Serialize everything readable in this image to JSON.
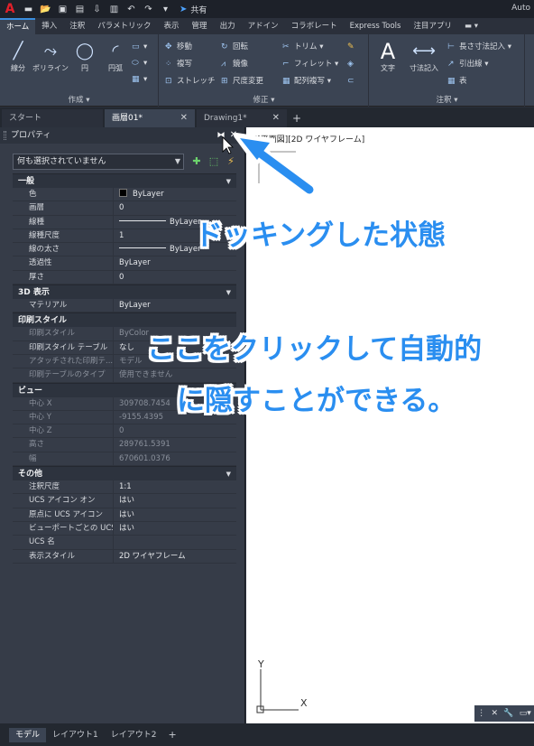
{
  "titlebar": {
    "logo": "A",
    "share_label": "共有",
    "app_title": "Auto"
  },
  "ribbon_tabs": [
    "ホーム",
    "挿入",
    "注釈",
    "パラメトリック",
    "表示",
    "管理",
    "出力",
    "アドイン",
    "コラボレート",
    "Express Tools",
    "注目アプリ",
    ""
  ],
  "ribbon": {
    "draw": {
      "label": "作成 ▾",
      "line": "線分",
      "polyline": "ポリライン",
      "circle": "円",
      "arc": "円弧"
    },
    "modify": {
      "label": "修正 ▾",
      "move": "移動",
      "rotate": "回転",
      "trim": "トリム",
      "copy": "複写",
      "mirror": "鏡像",
      "fillet": "フィレット",
      "stretch": "ストレッチ",
      "scale": "尺度変更",
      "array": "配列複写"
    },
    "annotation": {
      "label": "注釈 ▾",
      "text": "文字",
      "dimension": "寸法記入",
      "linear": "長さ寸法記入",
      "leader": "引出線",
      "table": "表"
    }
  },
  "doc_tabs": [
    {
      "label": "スタート",
      "close": ""
    },
    {
      "label": "画層01*",
      "close": "✕"
    },
    {
      "label": "Drawing1*",
      "close": "✕"
    }
  ],
  "palette": {
    "title": "プロパティ",
    "selection": "何も選択されていません",
    "categories": [
      {
        "name": "一般",
        "rows": [
          {
            "k": "色",
            "v": "ByLayer"
          },
          {
            "k": "画層",
            "v": "0"
          },
          {
            "k": "線種",
            "v": "ByLayer"
          },
          {
            "k": "線種尺度",
            "v": "1"
          },
          {
            "k": "線の太さ",
            "v": "ByLayer"
          },
          {
            "k": "透過性",
            "v": "ByLayer"
          },
          {
            "k": "厚さ",
            "v": "0"
          }
        ]
      },
      {
        "name": "3D 表示",
        "rows": [
          {
            "k": "マテリアル",
            "v": "ByLayer"
          }
        ]
      },
      {
        "name": "印刷スタイル",
        "rows": [
          {
            "k": "印刷スタイル",
            "v": "ByColor"
          },
          {
            "k": "印刷スタイル テーブル",
            "v": "なし"
          },
          {
            "k": "アタッチされた印刷テ...",
            "v": "モデル"
          },
          {
            "k": "印刷テーブルのタイプ",
            "v": "使用できません"
          }
        ]
      },
      {
        "name": "ビュー",
        "rows": [
          {
            "k": "中心 X",
            "v": "309708.7454"
          },
          {
            "k": "中心 Y",
            "v": "-9155.4395"
          },
          {
            "k": "中心 Z",
            "v": "0"
          },
          {
            "k": "高さ",
            "v": "289761.5391"
          },
          {
            "k": "幅",
            "v": "670601.0376"
          }
        ]
      },
      {
        "name": "その他",
        "rows": [
          {
            "k": "注釈尺度",
            "v": "1:1"
          },
          {
            "k": "UCS アイコン オン",
            "v": "はい"
          },
          {
            "k": "原点に UCS アイコン",
            "v": "はい"
          },
          {
            "k": "ビューポートごとの UCS",
            "v": "はい"
          },
          {
            "k": "UCS 名",
            "v": ""
          },
          {
            "k": "表示スタイル",
            "v": "2D ワイヤフレーム"
          }
        ]
      }
    ]
  },
  "canvas": {
    "viewport_label": "[-][平面図][2D ワイヤフレーム]",
    "ucs_x": "X",
    "ucs_y": "Y"
  },
  "layout_tabs": [
    "モデル",
    "レイアウト1",
    "レイアウト2"
  ],
  "annotations": {
    "docked": "ドッキングした状態",
    "hint_line1": "ここをクリックして自動的",
    "hint_line2": "に隠すことができる。"
  },
  "colors": {
    "accent": "#2a8ef0",
    "panel": "#363c48",
    "canvas": "#ffffff"
  }
}
